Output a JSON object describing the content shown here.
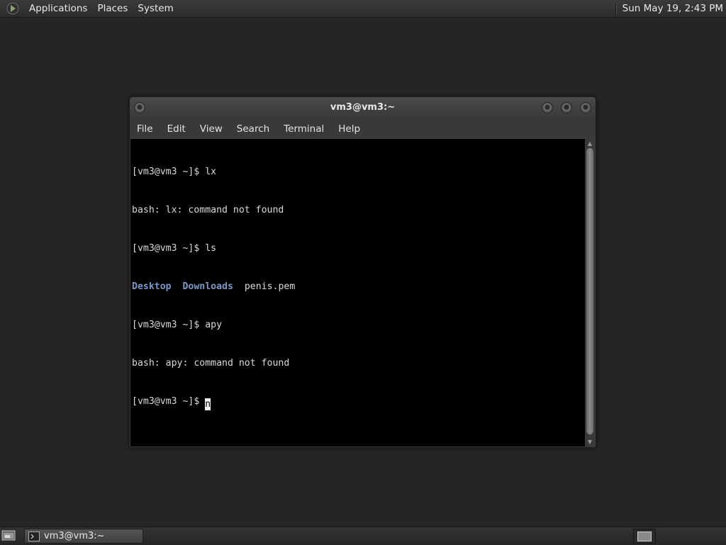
{
  "top_panel": {
    "menus": [
      "Applications",
      "Places",
      "System"
    ],
    "clock": "Sun May 19,  2:43 PM"
  },
  "window": {
    "title": "vm3@vm3:~",
    "menu": [
      "File",
      "Edit",
      "View",
      "Search",
      "Terminal",
      "Help"
    ]
  },
  "terminal": {
    "lines": [
      "[vm3@vm3 ~]$ lx",
      "bash: lx: command not found",
      "[vm3@vm3 ~]$ ls"
    ],
    "ls_output": {
      "dir1": "Desktop",
      "dir2": "Downloads",
      "file1": "penis.pem"
    },
    "lines_after": [
      "[vm3@vm3 ~]$ apy",
      "bash: apy: command not found"
    ],
    "prompt": "[vm3@vm3 ~]$ ",
    "typed": "n"
  },
  "taskbar": {
    "task_label": "vm3@vm3:~"
  },
  "colors": {
    "directory": "#7a97c9",
    "terminal_bg": "#000000",
    "desktop_bg": "#252525"
  },
  "icons": {
    "app_menu": "gnome-foot-icon",
    "show_desktop": "show-desktop-icon",
    "task": "terminal-icon"
  }
}
